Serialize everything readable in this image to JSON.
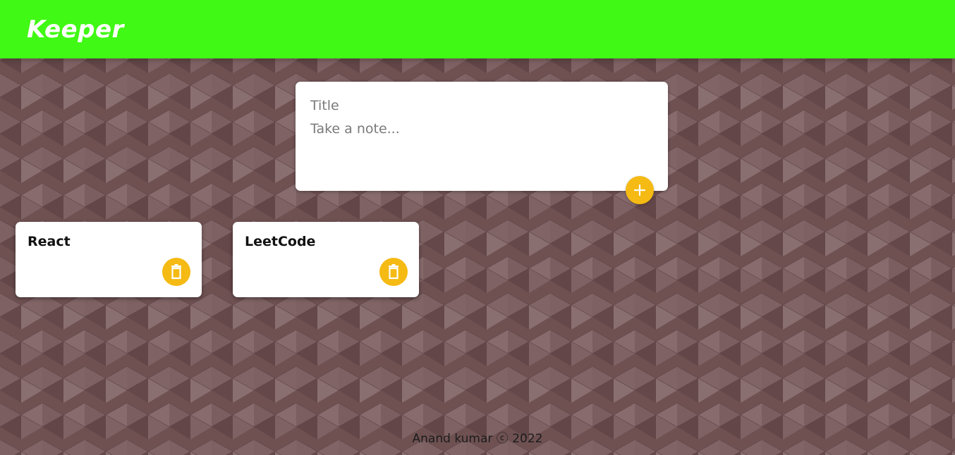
{
  "header": {
    "title": "Keeper"
  },
  "create_note": {
    "title_placeholder": "Title",
    "content_placeholder": "Take a note...",
    "add_icon": "add-icon"
  },
  "notes": [
    {
      "title": "React",
      "content": "",
      "delete_icon": "delete-icon"
    },
    {
      "title": "LeetCode",
      "content": "",
      "delete_icon": "delete-icon"
    }
  ],
  "footer": {
    "text": "Anand kumar ⓒ 2022"
  },
  "colors": {
    "header_bg": "#40f914",
    "accent": "#f5ba13",
    "page_bg": "#6f5152",
    "card_bg": "#ffffff"
  }
}
